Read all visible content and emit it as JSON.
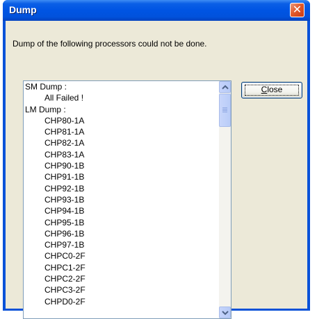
{
  "window": {
    "title": "Dump",
    "close_glyph": "✕"
  },
  "message": "Dump of the following processors could not be done.",
  "list": {
    "items": [
      {
        "text": "SM Dump :",
        "indent": false
      },
      {
        "text": "All Failed !",
        "indent": true
      },
      {
        "text": "LM Dump :",
        "indent": false
      },
      {
        "text": "CHP80-1A",
        "indent": true
      },
      {
        "text": "CHP81-1A",
        "indent": true
      },
      {
        "text": "CHP82-1A",
        "indent": true
      },
      {
        "text": "CHP83-1A",
        "indent": true
      },
      {
        "text": "CHP90-1B",
        "indent": true
      },
      {
        "text": "CHP91-1B",
        "indent": true
      },
      {
        "text": "CHP92-1B",
        "indent": true
      },
      {
        "text": "CHP93-1B",
        "indent": true
      },
      {
        "text": "CHP94-1B",
        "indent": true
      },
      {
        "text": "CHP95-1B",
        "indent": true
      },
      {
        "text": "CHP96-1B",
        "indent": true
      },
      {
        "text": "CHP97-1B",
        "indent": true
      },
      {
        "text": "CHPC0-2F",
        "indent": true
      },
      {
        "text": "CHPC1-2F",
        "indent": true
      },
      {
        "text": "CHPC2-2F",
        "indent": true
      },
      {
        "text": "CHPC3-2F",
        "indent": true
      },
      {
        "text": "CHPD0-2F",
        "indent": true
      }
    ]
  },
  "buttons": {
    "close_mnemonic": "C",
    "close_rest": "lose"
  },
  "colors": {
    "titlebar": "#0054e3",
    "face": "#ece9d8",
    "close_x": "#e35b2c"
  }
}
